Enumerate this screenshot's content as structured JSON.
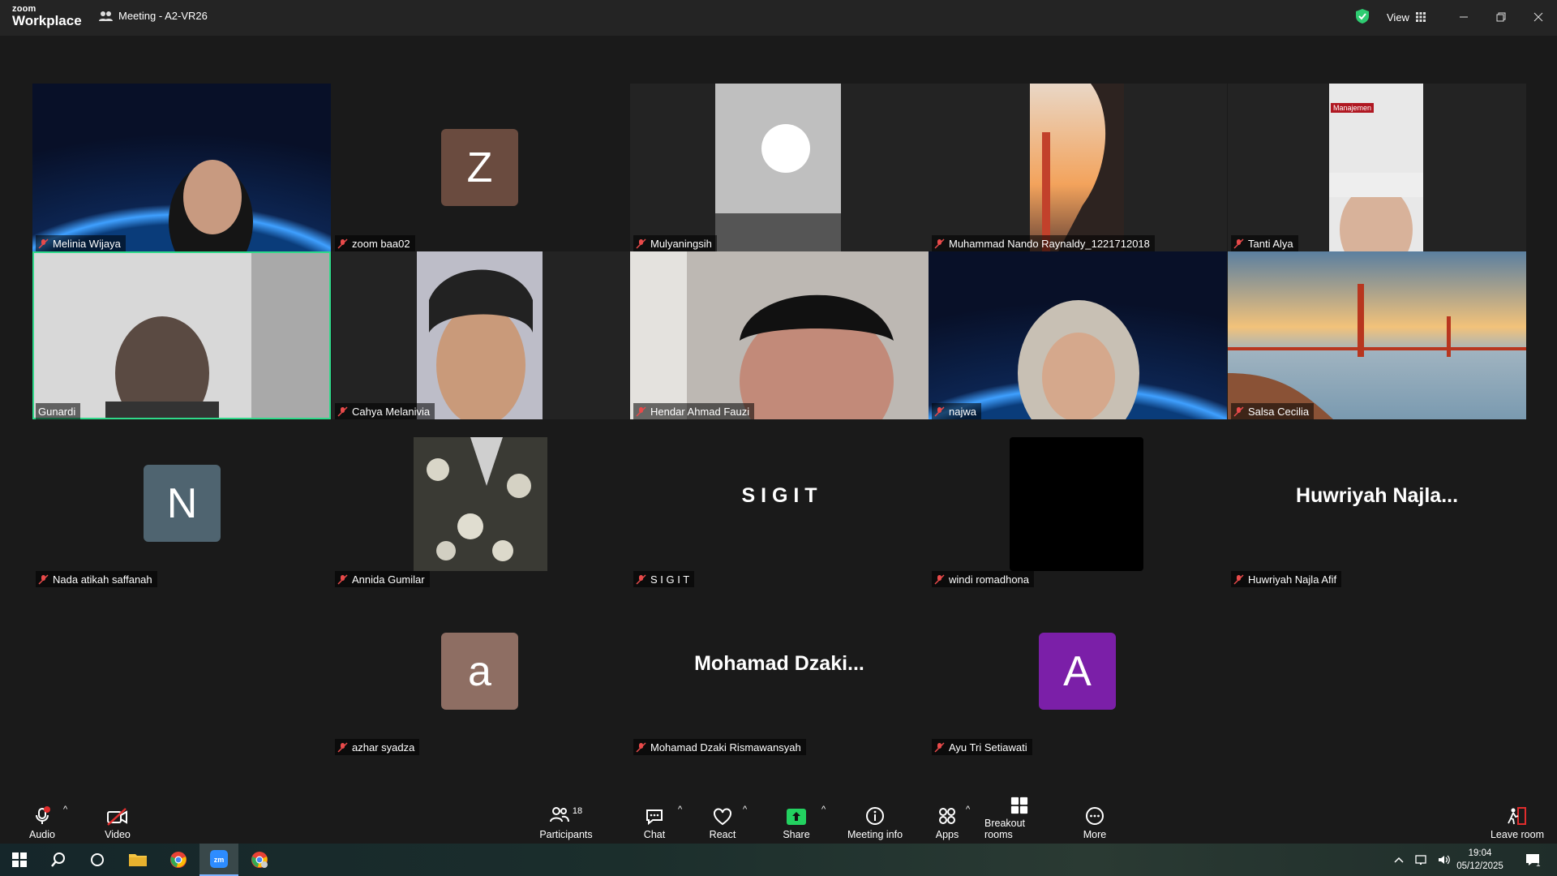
{
  "app": {
    "logo_line1": "zoom",
    "logo_line2": "Workplace",
    "meeting_title": "Meeting - A2-VR26",
    "view_label": "View"
  },
  "tiles": [
    {
      "name": "Melinia Wijaya"
    },
    {
      "name": "zoom baa02",
      "avatar": "Z",
      "avatar_color": "#6a4b3f"
    },
    {
      "name": "Mulyaningsih"
    },
    {
      "name": "Muhammad Nando Raynaldy_1221712018"
    },
    {
      "name": "Tanti Alya",
      "overlay": "Manajemen"
    },
    {
      "name": "Gunardi"
    },
    {
      "name": "Cahya Melanivia"
    },
    {
      "name": "Hendar Ahmad Fauzi"
    },
    {
      "name": "najwa"
    },
    {
      "name": "Salsa Cecilia"
    },
    {
      "name": "Nada atikah saffanah",
      "avatar": "N",
      "avatar_color": "#4f6470"
    },
    {
      "name": "Annida Gumilar"
    },
    {
      "name": "S I G I T",
      "display": "S I G I T"
    },
    {
      "name": "windi romadhona"
    },
    {
      "name": "Huwriyah Najla Afif",
      "display": "Huwriyah  Najla..."
    },
    {
      "name": "azhar syadza",
      "avatar": "a",
      "avatar_color": "#8e6e63"
    },
    {
      "name": "Mohamad Dzaki Rismawansyah",
      "display": "Mohamad  Dzaki..."
    },
    {
      "name": "Ayu Tri Setiawati",
      "avatar": "A",
      "avatar_color": "#7b1fa8"
    }
  ],
  "toolbar": {
    "audio": "Audio",
    "video": "Video",
    "participants": "Participants",
    "participants_count": "18",
    "chat": "Chat",
    "react": "React",
    "share": "Share",
    "meeting_info": "Meeting info",
    "apps": "Apps",
    "breakout": "Breakout rooms",
    "more": "More",
    "leave": "Leave room"
  },
  "taskbar": {
    "time": "19:04",
    "date": "05/12/2025",
    "notif_count": "1"
  },
  "colors": {
    "accent_green": "#2fd98a",
    "share_green": "#23d160"
  }
}
